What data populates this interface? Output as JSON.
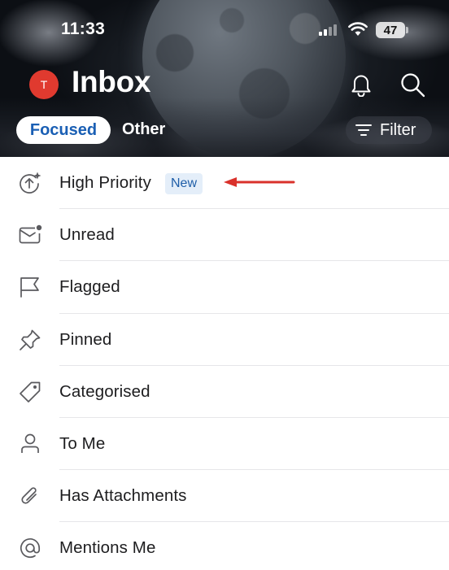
{
  "status_bar": {
    "time": "11:33",
    "battery": "47"
  },
  "header": {
    "avatar_initial": "T",
    "title": "Inbox",
    "tabs": [
      {
        "label": "Focused",
        "selected": true
      },
      {
        "label": "Other",
        "selected": false
      }
    ],
    "filter_label": "Filter"
  },
  "filters": [
    {
      "label": "High Priority",
      "icon": "high-priority-sparkle-icon",
      "badge": "New"
    },
    {
      "label": "Unread",
      "icon": "unread-envelope-icon"
    },
    {
      "label": "Flagged",
      "icon": "flag-icon"
    },
    {
      "label": "Pinned",
      "icon": "pin-icon"
    },
    {
      "label": "Categorised",
      "icon": "tag-icon"
    },
    {
      "label": "To Me",
      "icon": "person-icon"
    },
    {
      "label": "Has Attachments",
      "icon": "paperclip-icon"
    },
    {
      "label": "Mentions Me",
      "icon": "at-sign-icon"
    }
  ],
  "colors": {
    "avatar": "#e03a2f",
    "focused_tab_text": "#1a5fb4",
    "badge_bg": "#e4eef9",
    "badge_text": "#1f5ea8",
    "annotation_arrow": "#d9312b"
  }
}
